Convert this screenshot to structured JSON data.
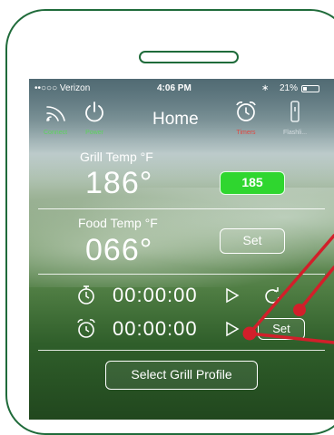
{
  "status_bar": {
    "carrier": "••○○○ Verizon",
    "time": "4:06 PM",
    "bluetooth": "∗",
    "battery_pct": "21%"
  },
  "navbar": {
    "title": "Home",
    "connect_label": "Connect",
    "power_label": "Power",
    "timers_label": "Timers",
    "flashlight_label": "Flashli..."
  },
  "grill": {
    "label": "Grill Temp °F",
    "value": "186°",
    "setpoint": "185"
  },
  "food": {
    "label": "Food Temp °F",
    "value": "066°",
    "set_label": "Set"
  },
  "timers": {
    "stopwatch": "00:00:00",
    "alarm": "00:00:00",
    "set_label": "Set"
  },
  "profile_button": "Select Grill Profile",
  "colors": {
    "frame": "#1f6b3a",
    "setpoint_bg": "#2fd62f",
    "annotation": "#d21f2a",
    "nav_green": "#5dd45d",
    "nav_red": "#e2473f"
  }
}
